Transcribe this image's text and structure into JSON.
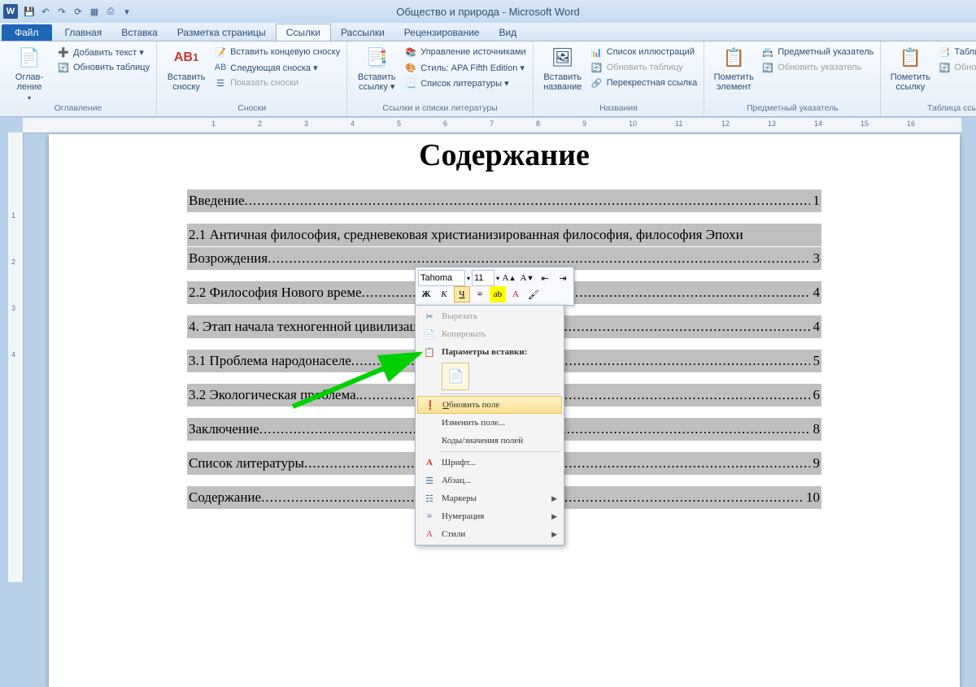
{
  "title": "Общество и природа  -  Microsoft Word",
  "qat_icons": [
    "save-icon",
    "undo-icon",
    "redo-icon",
    "refresh-icon",
    "table-icon",
    "print-icon",
    "dropdown-icon"
  ],
  "tabs": {
    "file": "Файл",
    "items": [
      "Главная",
      "Вставка",
      "Разметка страницы",
      "Ссылки",
      "Рассылки",
      "Рецензирование",
      "Вид"
    ],
    "active_index": 3
  },
  "ribbon": {
    "groups": [
      {
        "label": "Оглавление",
        "big": {
          "icon": "📄",
          "text": "Оглав­ление"
        },
        "rows": [
          "Добавить текст ▾",
          "Обновить таблицу"
        ]
      },
      {
        "label": "Сноски",
        "big": {
          "icon": "AB¹",
          "text": "Вставить сноску"
        },
        "rows": [
          "Вставить концевую сноску",
          "Следующая сноска ▾",
          "Показать сноски"
        ]
      },
      {
        "label": "Ссылки и списки литературы",
        "big": {
          "icon": "📑",
          "text": "Вставить ссылку ▾"
        },
        "rows": [
          "Управление источниками",
          "Стиль:  APA Fifth Edition ▾",
          "Список литературы ▾"
        ]
      },
      {
        "label": "Названия",
        "big": {
          "icon": "🖼",
          "text": "Вставить название"
        },
        "rows": [
          "Список иллюстраций",
          "Обновить таблицу",
          "Перекрестная ссылка"
        ]
      },
      {
        "label": "Предметный указатель",
        "big": {
          "icon": "📋",
          "text": "Пометить элемент"
        },
        "rows": [
          "Предметный указатель",
          "Обновить указатель"
        ]
      },
      {
        "label": "Таблица ссылок",
        "big": {
          "icon": "📋",
          "text": "Пометить ссылку"
        },
        "rows": [
          "Таблица ссылок",
          "Обновить таблицу"
        ]
      }
    ]
  },
  "ruler_marks": [
    "",
    "1",
    "2",
    "3",
    "4",
    "5",
    "6",
    "7",
    "8",
    "9",
    "10",
    "11",
    "12",
    "13",
    "14",
    "15",
    "16"
  ],
  "vruler_marks": [
    "",
    "1",
    "2",
    "3",
    "4"
  ],
  "doc": {
    "heading": "Содержание",
    "toc": [
      {
        "text": "Введение",
        "page": "1"
      },
      {
        "text": "2.1 Античная философия, средневековая христианизированная философия, философия Эпохи",
        "wrap": "Возрождения",
        "page": "3"
      },
      {
        "text": "2.2 Философия Нового време",
        "page": "4",
        "cut": true
      },
      {
        "text": "4. Этап начала техногенной цивилизации",
        "page": "4",
        "cut": true
      },
      {
        "text": "3.1 Проблема народонаселе",
        "page": "5",
        "cut": true
      },
      {
        "text": "3.2 Экологическая проблема.",
        "page": "6"
      },
      {
        "text": "Заключение ",
        "page": "8"
      },
      {
        "text": "Список литературы",
        "page": "9",
        "cut": true
      },
      {
        "text": "Содержание",
        "page": "10"
      }
    ]
  },
  "mini": {
    "font": "Tahoma",
    "size": "11"
  },
  "ctx": {
    "cut": "Вырезать",
    "copy": "Копировать",
    "paste_header": "Параметры вставки:",
    "update": "Обновить поле",
    "edit": "Изменить поле...",
    "codes": "Коды/значения полей",
    "font": "Шрифт...",
    "para": "Абзац...",
    "bullets": "Маркеры",
    "numbering": "Нумерация",
    "styles": "Стили"
  }
}
